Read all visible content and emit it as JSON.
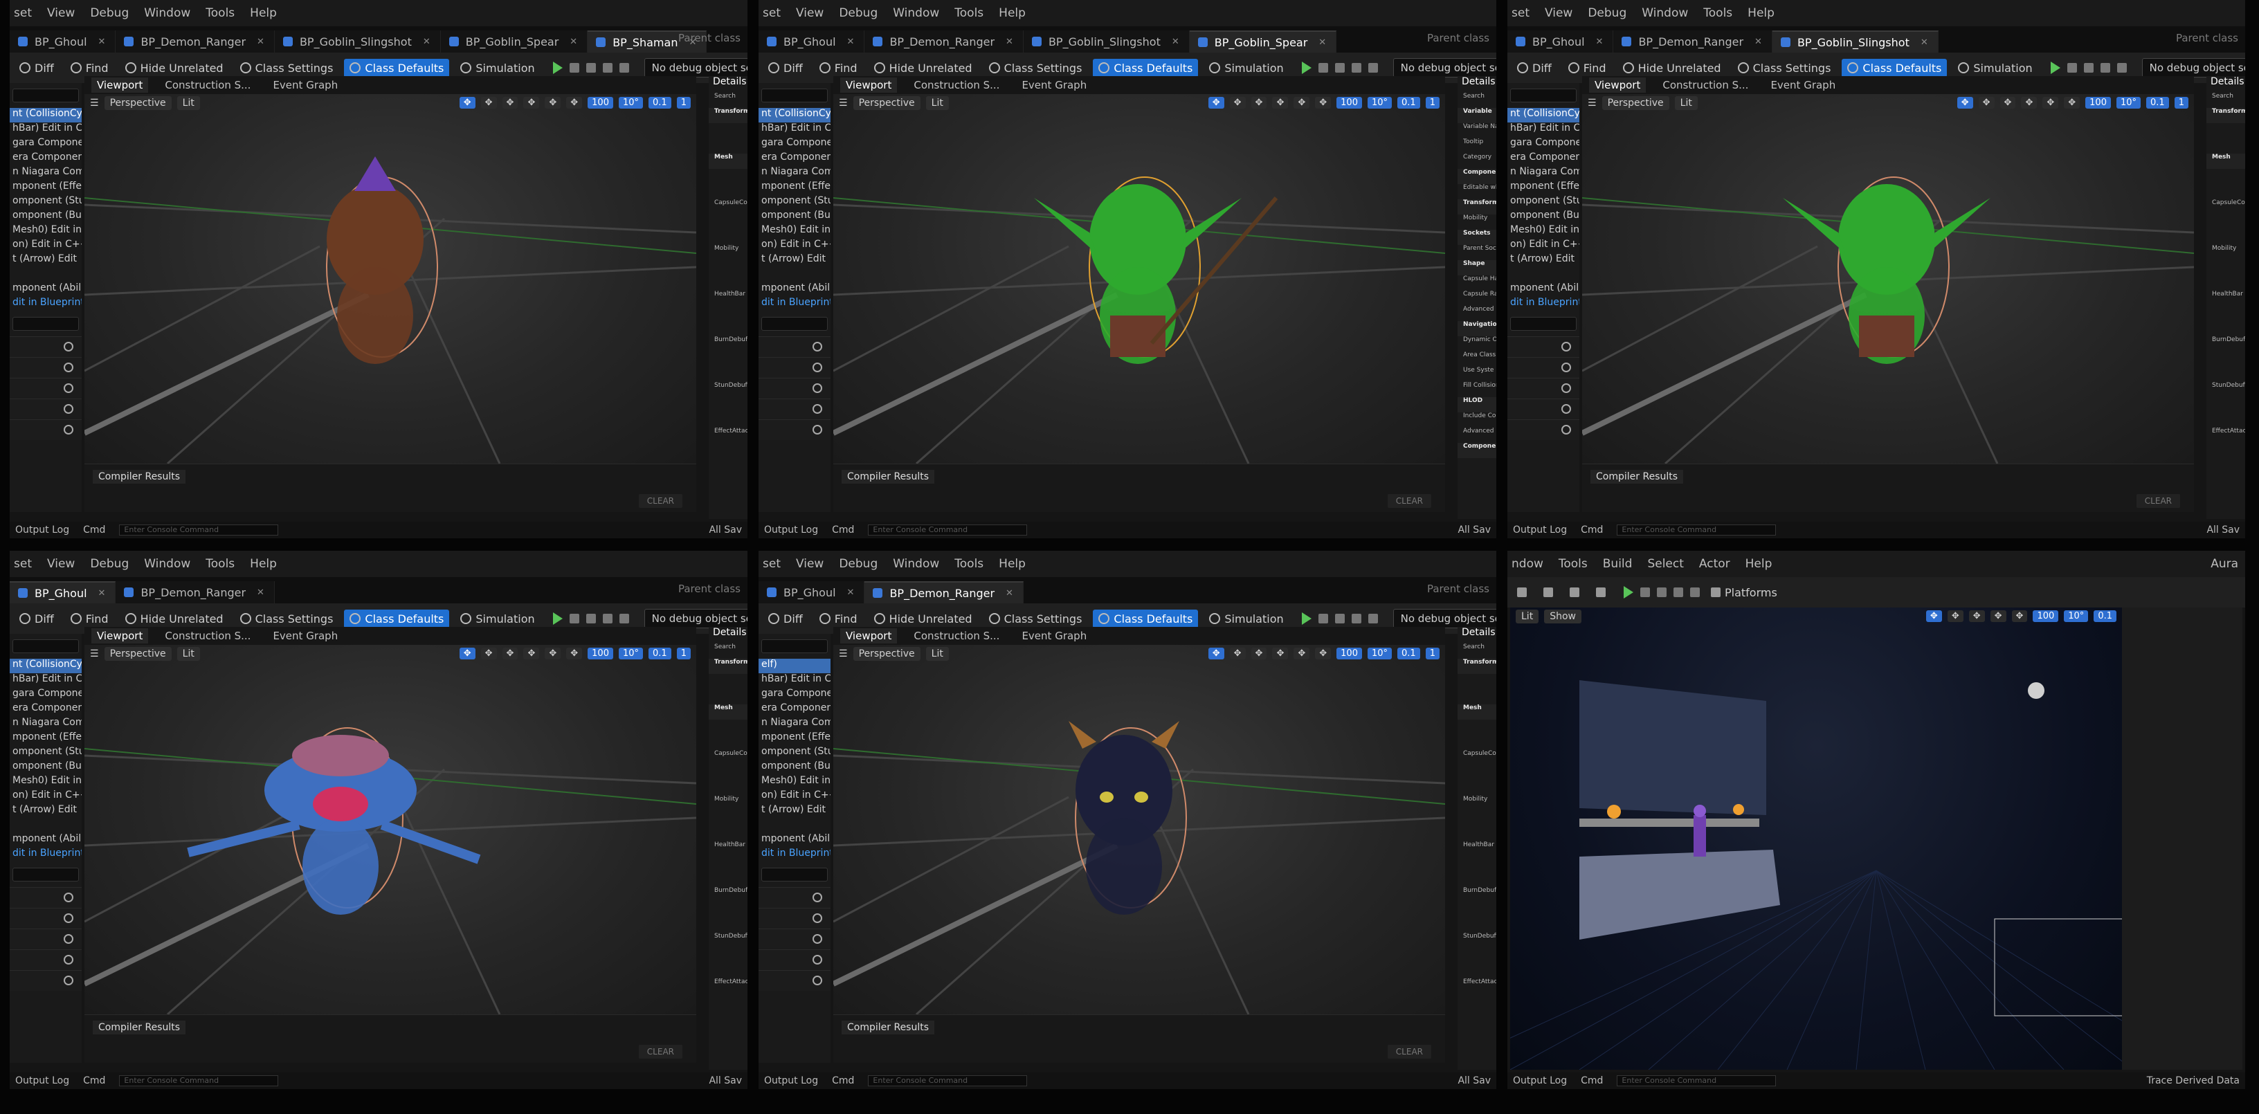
{
  "bp_menu": [
    "set",
    "View",
    "Debug",
    "Window",
    "Tools",
    "Help"
  ],
  "level_menu": [
    "ndow",
    "Tools",
    "Build",
    "Select",
    "Actor",
    "Help"
  ],
  "level_user": "Aura",
  "parent_class": "Parent class",
  "toolbar": {
    "diff": "Diff",
    "find": "Find",
    "hide_unrelated": "Hide Unrelated",
    "class_settings": "Class Settings",
    "class_defaults": "Class Defaults",
    "simulation": "Simulation",
    "debug_select": "No debug object selected"
  },
  "viewport_tabs": [
    "Viewport",
    "Construction S...",
    "Event Graph"
  ],
  "viewport_head": {
    "perspective": "Perspective",
    "lit": "Lit",
    "grid": "100",
    "angle": "10°",
    "scale": "0.1",
    "cams": "1"
  },
  "details_label": "Details",
  "details_search": "Search",
  "components": [
    "nt (CollisionCy",
    "hBar)  Edit in C",
    "gara Compone",
    "era Component",
    "n Niagara Com",
    "mponent (Effec",
    "omponent (StunD",
    "omponent (BurnD",
    "Mesh0)  Edit in",
    "on)  Edit in C++",
    "t (Arrow)  Edit",
    "",
    "mponent (Abilit",
    "dit in Blueprint"
  ],
  "ranger_first": "elf)",
  "details_mesh_lines": [
    "Transform",
    "Mesh",
    "CapsuleCo",
    "Mobility",
    "HealthBar",
    "BurnDebuff",
    "StunDebuff",
    "EffectAttac"
  ],
  "details_spear_lines": [
    "Variable",
    "Variable Na",
    "Tooltip",
    "Category",
    "Componen",
    "Editable wh",
    "Transform",
    "Mobility",
    "Sockets",
    "Parent Soc",
    "Shape",
    "Capsule Ha",
    "Capsule Ra",
    "Advanced",
    "Navigation",
    "Dynamic O",
    "Area Class",
    "Use Syste",
    "Fill Collision",
    "HLOD",
    "Include Co",
    "Advanced",
    "Componen"
  ],
  "compiler_results": "Compiler Results",
  "clear": "CLEAR",
  "status": {
    "output_log": "Output Log",
    "cmd": "Cmd",
    "console": "Enter Console Command",
    "all_saved": "All Sav"
  },
  "level_status": {
    "trace": "Trace",
    "derived": "Derived Data"
  },
  "level_toolbar": {
    "platforms": "Platforms",
    "lit": "Lit",
    "show": "Show"
  },
  "panels": [
    {
      "id": "shaman",
      "tabs": [
        "BP_Ghoul",
        "BP_Demon_Ranger",
        "BP_Goblin_Slingshot",
        "BP_Goblin_Spear",
        "BP_Shaman"
      ],
      "active": 4
    },
    {
      "id": "spear",
      "tabs": [
        "BP_Ghoul",
        "BP_Demon_Ranger",
        "BP_Goblin_Slingshot",
        "BP_Goblin_Spear"
      ],
      "active": 3
    },
    {
      "id": "slingshot",
      "tabs": [
        "BP_Ghoul",
        "BP_Demon_Ranger",
        "BP_Goblin_Slingshot"
      ],
      "active": 2
    },
    {
      "id": "ghoul",
      "tabs": [
        "BP_Ghoul",
        "BP_Demon_Ranger"
      ],
      "active": 0
    },
    {
      "id": "ranger",
      "tabs": [
        "BP_Ghoul",
        "BP_Demon_Ranger"
      ],
      "active": 1
    }
  ],
  "colors": {
    "accent": "#1f6fd1",
    "goblin": "#2fa82f",
    "ghoul": "#3f6fc0",
    "demon": "#1c1f3a",
    "shaman": "#7a4a2a"
  }
}
